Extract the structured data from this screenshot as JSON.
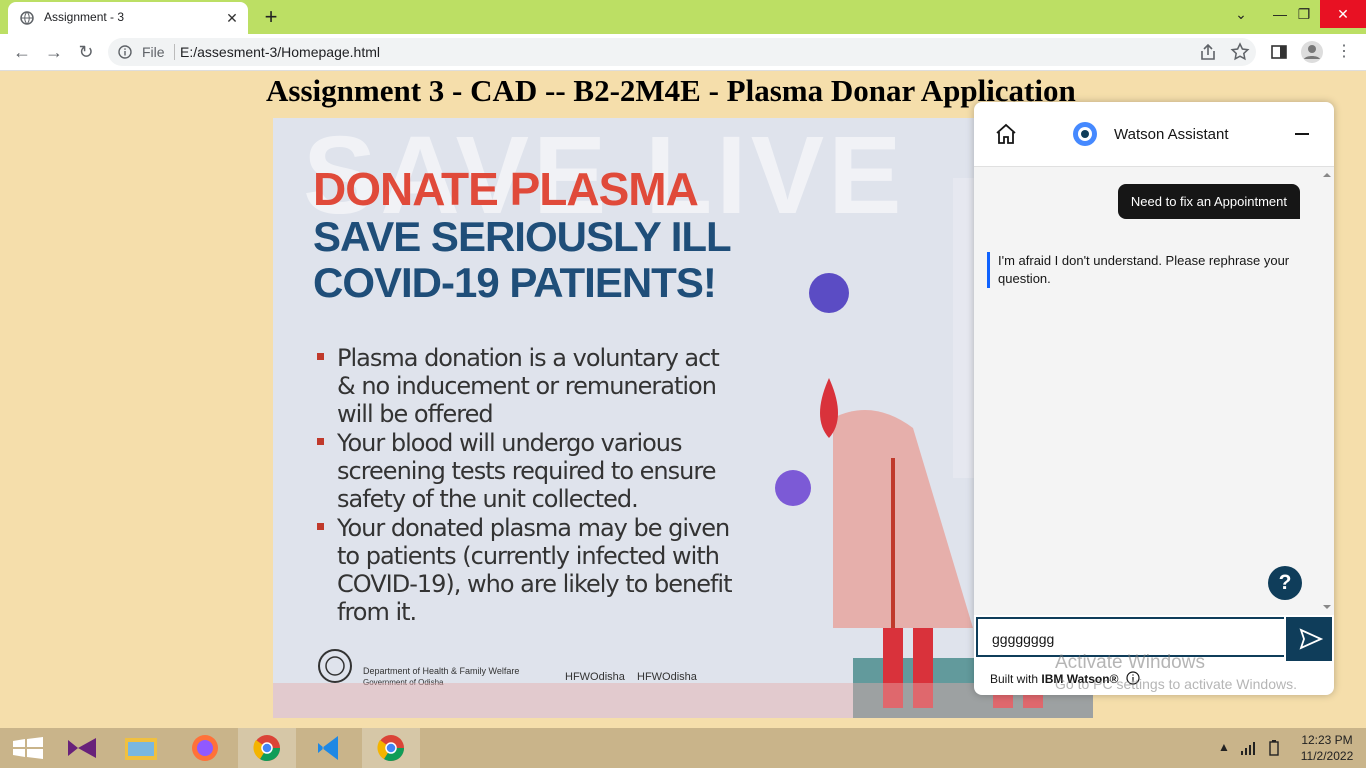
{
  "browser": {
    "tab_title": "Assignment - 3",
    "tab_close": "✕",
    "new_tab": "+",
    "file_label": "File",
    "url": "E:/assesment-3/Homepage.html"
  },
  "page": {
    "heading": "Assignment 3 - CAD -- B2-2M4E - Plasma Donar Application"
  },
  "poster": {
    "bg_text": "SAVE LIVE",
    "title_line1": "DONATE PLASMA",
    "title_line2": "SAVE SERIOUSLY ILL",
    "title_line3": "COVID-19 PATIENTS!",
    "bullets": [
      "Plasma donation is a voluntary act & no inducement or remuneration will be offered",
      "Your blood will undergo various screening tests required to ensure safety of the unit collected.",
      "Your donated plasma may be given to patients (currently infected with COVID-19), who are likely to benefit from it."
    ],
    "dept_line1": "Department of Health & Family Welfare",
    "dept_line2": "Government of Odisha",
    "social1": "HFWOdisha",
    "social2": "HFWOdisha"
  },
  "watson": {
    "title": "Watson Assistant",
    "user_message": "Need to fix an Appointment",
    "bot_message": "I'm afraid I don't understand. Please rephrase your question.",
    "input_value": "gggggggg",
    "help": "?",
    "built_with_prefix": "Built with ",
    "built_with_brand": "IBM Watson®"
  },
  "watermark": {
    "line1": "Activate Windows",
    "line2": "Go to PC settings to activate Windows."
  },
  "taskbar": {
    "time": "12:23 PM",
    "date": "11/2/2022"
  },
  "colors": {
    "titlebar": "#bcdf64",
    "page_bg": "#f5deab",
    "watson_accent": "#0f3d5a",
    "taskbar": "#c9b48a"
  }
}
